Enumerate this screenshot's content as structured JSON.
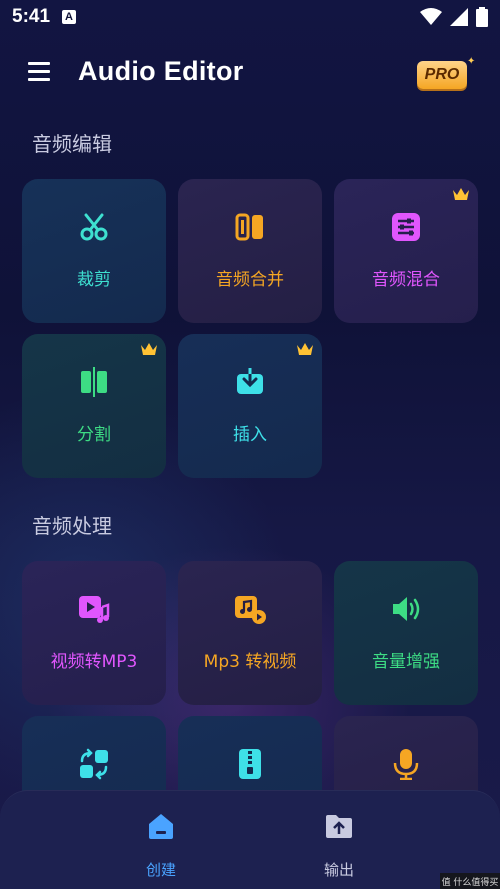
{
  "status_bar": {
    "time": "5:41",
    "badge": "A"
  },
  "app_bar": {
    "title": "Audio Editor",
    "pro_label": "PRO"
  },
  "sections": {
    "edit": {
      "title": "音频编辑",
      "cards": [
        {
          "label": "裁剪",
          "icon": "scissors-icon",
          "color": "#3ee0d0",
          "premium": false
        },
        {
          "label": "音频合并",
          "icon": "merge-icon",
          "color": "#f5a623",
          "premium": false
        },
        {
          "label": "音频混合",
          "icon": "sliders-icon",
          "color": "#e056fd",
          "premium": true
        },
        {
          "label": "分割",
          "icon": "split-icon",
          "color": "#3ddc84",
          "premium": true
        },
        {
          "label": "插入",
          "icon": "insert-icon",
          "color": "#3ee0e8",
          "premium": true
        }
      ]
    },
    "process": {
      "title": "音频处理",
      "cards": [
        {
          "label": "视频转MP3",
          "icon": "video-music-icon",
          "color": "#e056fd",
          "premium": false
        },
        {
          "label": "Mp3 转视频",
          "icon": "music-video-icon",
          "color": "#f5a623",
          "premium": false
        },
        {
          "label": "音量增强",
          "icon": "volume-icon",
          "color": "#3ddc84",
          "premium": false
        },
        {
          "label": "",
          "icon": "convert-icon",
          "color": "#3ee0e8",
          "premium": false
        },
        {
          "label": "",
          "icon": "zip-icon",
          "color": "#3ee0e8",
          "premium": false
        },
        {
          "label": "",
          "icon": "microphone-icon",
          "color": "#f5a623",
          "premium": false
        }
      ]
    }
  },
  "bottom_nav": {
    "items": [
      {
        "label": "创建",
        "icon": "home-icon",
        "active": true,
        "color": "#4aa3ff"
      },
      {
        "label": "输出",
        "icon": "folder-upload-icon",
        "active": false,
        "color": "#c8cae0"
      }
    ]
  },
  "watermark": "值 什么值得买"
}
